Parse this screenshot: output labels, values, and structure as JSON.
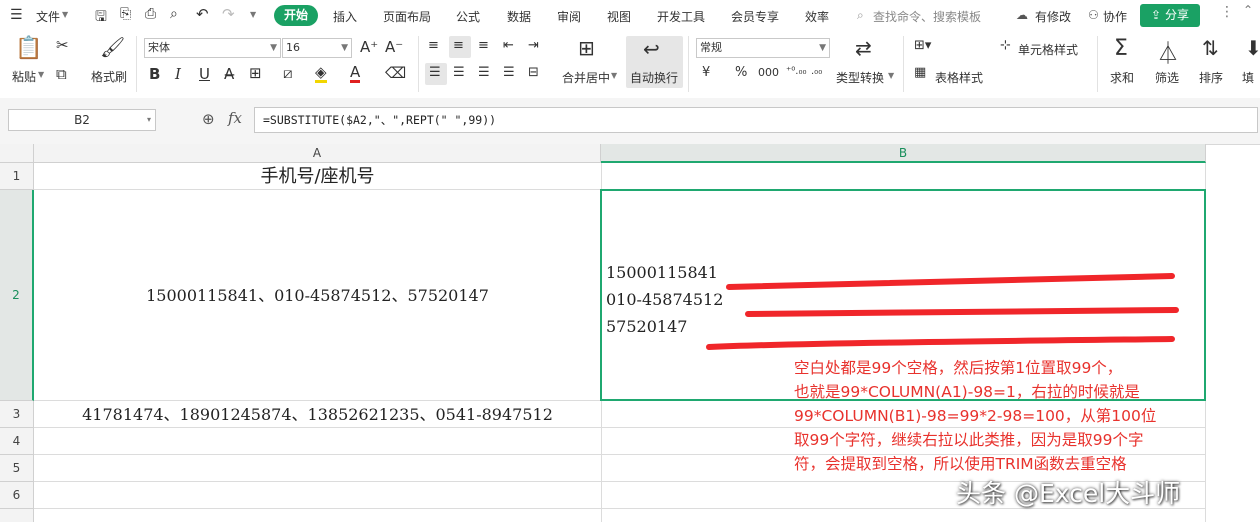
{
  "menubar": {
    "file": "文件",
    "tabs": [
      "开始",
      "插入",
      "页面布局",
      "公式",
      "数据",
      "审阅",
      "视图",
      "开发工具",
      "会员专享",
      "效率"
    ],
    "search": "查找命令、搜索模板",
    "modified": "有修改",
    "collab": "协作",
    "share": "分享"
  },
  "ribbon": {
    "paste": "粘贴",
    "format_painter": "格式刷",
    "font_name": "宋体",
    "font_size": "16",
    "merge_center": "合并居中",
    "wrap_text": "自动换行",
    "number_format": "常规",
    "type_convert": "类型转换",
    "cell_style": "单元格样式",
    "table_style": "表格样式",
    "sum": "求和",
    "filter": "筛选",
    "sort": "排序",
    "fill": "填"
  },
  "formula_bar": {
    "name_box": "B2",
    "fx": "fx",
    "formula": "=SUBSTITUTE($A2,\"、\",REPT(\" \",99))"
  },
  "grid": {
    "columns": [
      "A",
      "B"
    ],
    "rows": [
      "1",
      "2",
      "3",
      "4",
      "5",
      "6"
    ],
    "a1": "手机号/座机号",
    "a2": "15000115841、010-45874512、57520147",
    "a3": "41781474、18901245874、13852621235、0541-8947512",
    "b2_lines": [
      "15000115841",
      "010-45874512",
      "57520147"
    ]
  },
  "annotation": {
    "color": "#e8322d",
    "lines": [
      "空白处都是99个空格，然后按第1位置取99个，",
      "也就是99*COLUMN(A1)-98=1，右拉的时候就是",
      "99*COLUMN(B1)-98=99*2-98=100，从第100位",
      "取99个字符，继续右拉以此类推，因为是取99个字",
      "符，会提取到空格，所以使用TRIM函数去重空格"
    ]
  },
  "watermark": "头条 @Excel大斗师",
  "colors": {
    "accent": "#1aa164",
    "selection": "#1fa870"
  }
}
